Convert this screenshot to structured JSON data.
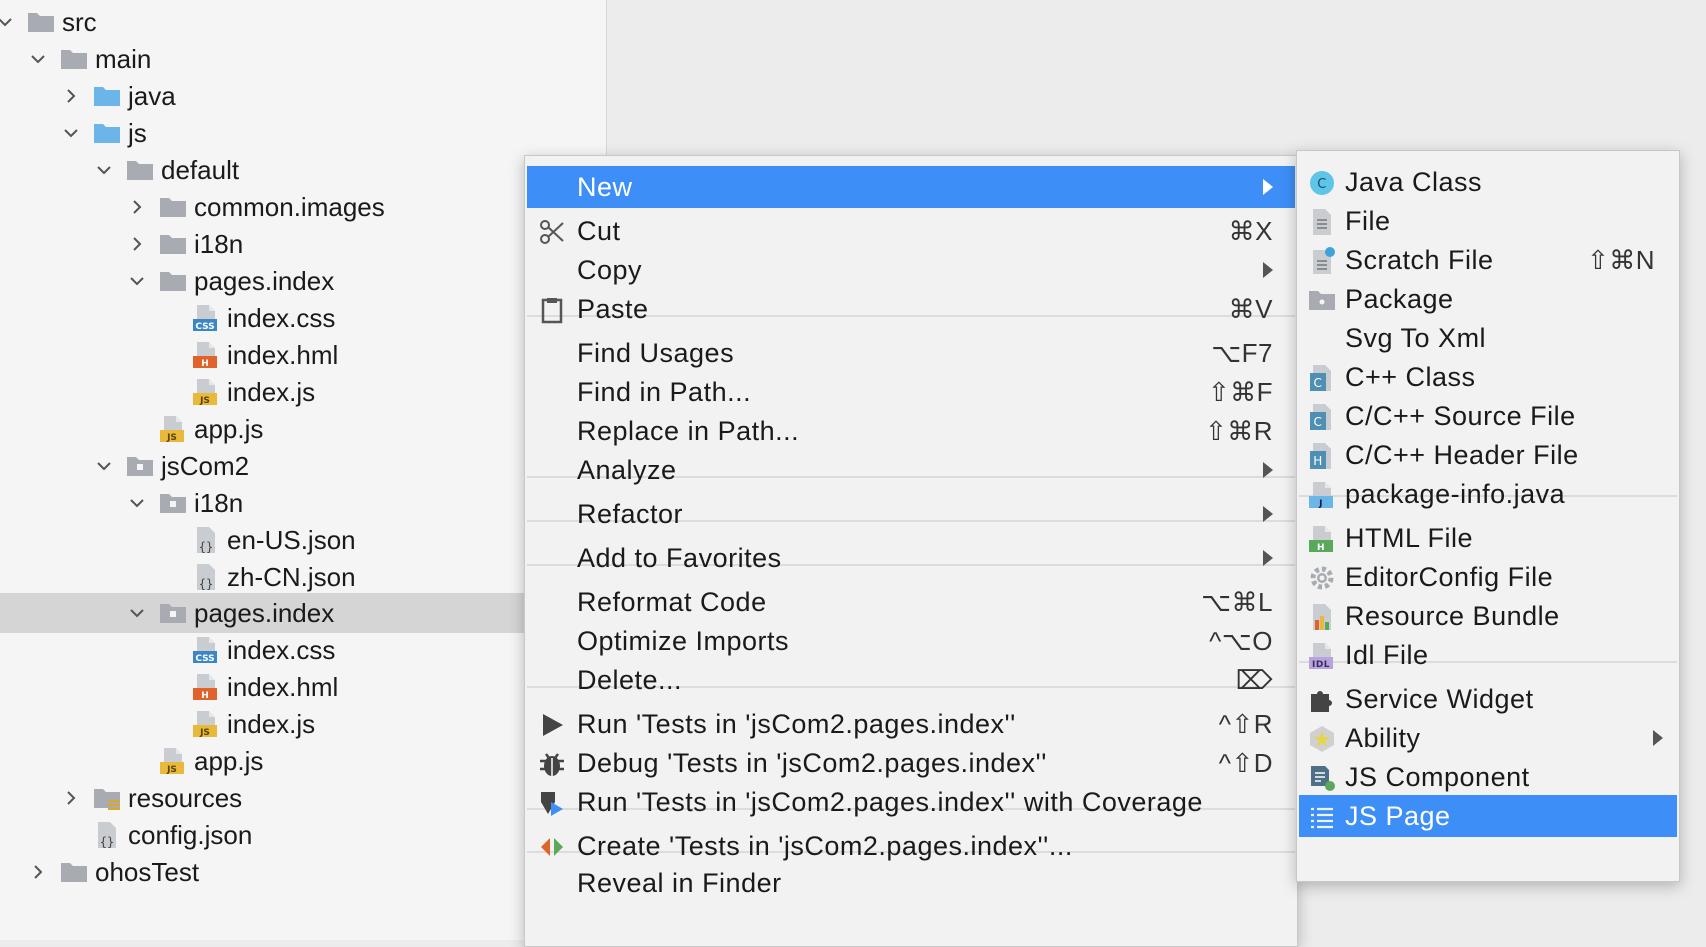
{
  "tree": {
    "rows": [
      {
        "label": "src",
        "chevron": "down",
        "icon": "folder-gray-icon"
      },
      {
        "label": "main",
        "chevron": "down",
        "icon": "folder-gray-icon"
      },
      {
        "label": "java",
        "chevron": "right",
        "icon": "folder-blue-icon"
      },
      {
        "label": "js",
        "chevron": "down",
        "icon": "folder-blue-icon"
      },
      {
        "label": "default",
        "chevron": "down",
        "icon": "folder-gray-icon"
      },
      {
        "label": "common.images",
        "chevron": "right",
        "icon": "folder-gray-icon"
      },
      {
        "label": "i18n",
        "chevron": "right",
        "icon": "folder-gray-icon"
      },
      {
        "label": "pages.index",
        "chevron": "down",
        "icon": "folder-gray-icon"
      },
      {
        "label": "index.css",
        "chevron": "",
        "icon": "css-file-icon"
      },
      {
        "label": "index.hml",
        "chevron": "",
        "icon": "hml-file-icon"
      },
      {
        "label": "index.js",
        "chevron": "",
        "icon": "js-file-icon"
      },
      {
        "label": "app.js",
        "chevron": "",
        "icon": "js-file-icon"
      },
      {
        "label": "jsCom2",
        "chevron": "down",
        "icon": "folder-module-icon"
      },
      {
        "label": "i18n",
        "chevron": "down",
        "icon": "folder-module-icon"
      },
      {
        "label": "en-US.json",
        "chevron": "",
        "icon": "json-file-icon"
      },
      {
        "label": "zh-CN.json",
        "chevron": "",
        "icon": "json-file-icon"
      },
      {
        "label": "pages.index",
        "chevron": "down",
        "icon": "folder-module-icon",
        "selected": true
      },
      {
        "label": "index.css",
        "chevron": "",
        "icon": "css-file-icon"
      },
      {
        "label": "index.hml",
        "chevron": "",
        "icon": "hml-file-icon"
      },
      {
        "label": "index.js",
        "chevron": "",
        "icon": "js-file-icon"
      },
      {
        "label": "app.js",
        "chevron": "",
        "icon": "js-file-icon"
      },
      {
        "label": "resources",
        "chevron": "right",
        "icon": "folder-resources-icon"
      },
      {
        "label": "config.json",
        "chevron": "",
        "icon": "json-file-icon"
      },
      {
        "label": "ohosTest",
        "chevron": "right",
        "icon": "folder-gray-icon"
      }
    ]
  },
  "context_menu": {
    "items": [
      {
        "label": "New",
        "shortcut": "",
        "submenu": true,
        "icon": "",
        "highlighted": true
      },
      {
        "label": "Cut",
        "shortcut": "⌘X",
        "submenu": false,
        "icon": "scissors-icon"
      },
      {
        "label": "Copy",
        "shortcut": "",
        "submenu": true,
        "icon": ""
      },
      {
        "label": "Paste",
        "shortcut": "⌘V",
        "submenu": false,
        "icon": "clipboard-icon"
      },
      {
        "label": "Find Usages",
        "shortcut": "⌥F7",
        "submenu": false,
        "icon": ""
      },
      {
        "label": "Find in Path...",
        "shortcut": "⇧⌘F",
        "submenu": false,
        "icon": ""
      },
      {
        "label": "Replace in Path...",
        "shortcut": "⇧⌘R",
        "submenu": false,
        "icon": ""
      },
      {
        "label": "Analyze",
        "shortcut": "",
        "submenu": true,
        "icon": ""
      },
      {
        "label": "Refactor",
        "shortcut": "",
        "submenu": true,
        "icon": ""
      },
      {
        "label": "Add to Favorites",
        "shortcut": "",
        "submenu": true,
        "icon": ""
      },
      {
        "label": "Reformat Code",
        "shortcut": "⌥⌘L",
        "submenu": false,
        "icon": ""
      },
      {
        "label": "Optimize Imports",
        "shortcut": "^⌥O",
        "submenu": false,
        "icon": ""
      },
      {
        "label": "Delete...",
        "shortcut": "⌦",
        "submenu": false,
        "icon": ""
      },
      {
        "label": "Run 'Tests in 'jsCom2.pages.index''",
        "shortcut": "^⇧R",
        "submenu": false,
        "icon": "run-icon"
      },
      {
        "label": "Debug 'Tests in 'jsCom2.pages.index''",
        "shortcut": "^⇧D",
        "submenu": false,
        "icon": "debug-icon"
      },
      {
        "label": "Run 'Tests in 'jsCom2.pages.index'' with Coverage",
        "shortcut": "",
        "submenu": false,
        "icon": "coverage-icon"
      },
      {
        "label": "Create 'Tests in 'jsCom2.pages.index''...",
        "shortcut": "",
        "submenu": false,
        "icon": "create-tests-icon"
      },
      {
        "label": "Reveal in Finder",
        "shortcut": "",
        "submenu": false,
        "icon": ""
      }
    ]
  },
  "new_submenu": {
    "items": [
      {
        "label": "Java Class",
        "shortcut": "",
        "submenu": false,
        "icon": "java-class-icon"
      },
      {
        "label": "File",
        "shortcut": "",
        "submenu": false,
        "icon": "file-icon"
      },
      {
        "label": "Scratch File",
        "shortcut": "⇧⌘N",
        "submenu": false,
        "icon": "scratch-file-icon"
      },
      {
        "label": "Package",
        "shortcut": "",
        "submenu": false,
        "icon": "package-icon"
      },
      {
        "label": "Svg To Xml",
        "shortcut": "",
        "submenu": false,
        "icon": ""
      },
      {
        "label": "C++ Class",
        "shortcut": "",
        "submenu": false,
        "icon": "cpp-class-icon"
      },
      {
        "label": "C/C++ Source File",
        "shortcut": "",
        "submenu": false,
        "icon": "cpp-source-icon"
      },
      {
        "label": "C/C++ Header File",
        "shortcut": "",
        "submenu": false,
        "icon": "cpp-header-icon"
      },
      {
        "label": "package-info.java",
        "shortcut": "",
        "submenu": false,
        "icon": "package-info-icon"
      },
      {
        "label": "HTML File",
        "shortcut": "",
        "submenu": false,
        "icon": "html-file-icon"
      },
      {
        "label": "EditorConfig File",
        "shortcut": "",
        "submenu": false,
        "icon": "gear-icon"
      },
      {
        "label": "Resource Bundle",
        "shortcut": "",
        "submenu": false,
        "icon": "resource-bundle-icon"
      },
      {
        "label": "Idl File",
        "shortcut": "",
        "submenu": false,
        "icon": "idl-file-icon"
      },
      {
        "label": "Service Widget",
        "shortcut": "",
        "submenu": false,
        "icon": "puzzle-icon"
      },
      {
        "label": "Ability",
        "shortcut": "",
        "submenu": true,
        "icon": "ability-icon"
      },
      {
        "label": "JS Component",
        "shortcut": "",
        "submenu": false,
        "icon": "js-component-icon"
      },
      {
        "label": "JS Page",
        "shortcut": "",
        "submenu": false,
        "icon": "js-page-icon",
        "highlighted": true
      }
    ]
  },
  "colors": {
    "highlight": "#3d8ef7",
    "folder_gray": "#a8acb2",
    "folder_blue": "#6bb5e8"
  }
}
